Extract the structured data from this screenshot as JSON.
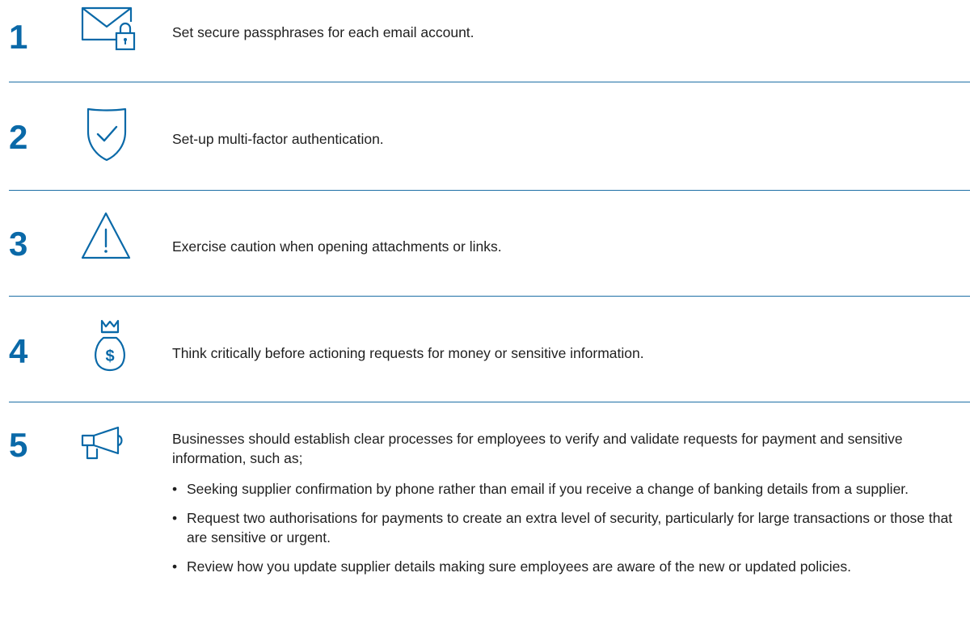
{
  "steps": [
    {
      "number": "1",
      "icon": "envelope-lock-icon",
      "text": "Set secure passphrases for each email account."
    },
    {
      "number": "2",
      "icon": "shield-check-icon",
      "text": "Set-up multi-factor authentication."
    },
    {
      "number": "3",
      "icon": "warning-triangle-icon",
      "text": "Exercise caution when opening attachments or links."
    },
    {
      "number": "4",
      "icon": "money-bag-icon",
      "text": "Think critically before actioning requests for money or sensitive information."
    },
    {
      "number": "5",
      "icon": "megaphone-icon",
      "text": "Businesses should establish clear processes for employees to verify and validate requests for payment and sensitive information, such as;",
      "bullets": [
        "Seeking supplier confirmation by phone rather than email if you receive a change of banking details from a supplier.",
        "Request two authorisations for payments to create an extra level of security, particularly for large transactions or those that are sensitive or urgent.",
        "Review how you update supplier details making sure employees are aware of the new or updated policies."
      ]
    }
  ],
  "theme": {
    "accent": "#0a69a8",
    "divider": "#1d6fa5"
  },
  "bullet_glyph": "•"
}
